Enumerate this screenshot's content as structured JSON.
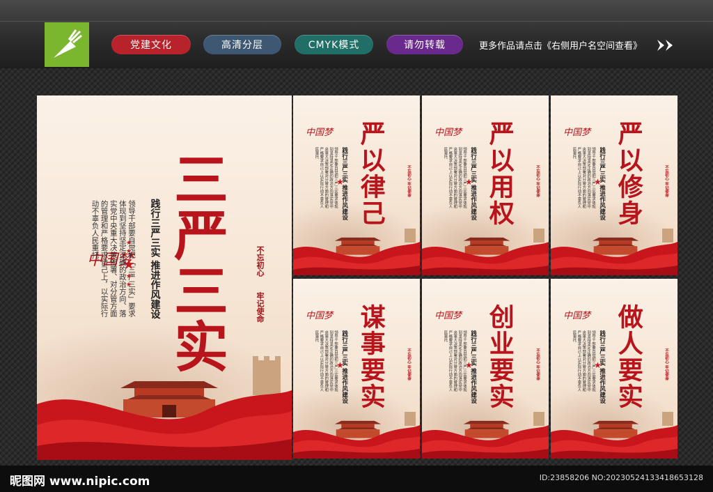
{
  "header": {
    "tags": [
      "党建文化",
      "高清分层",
      "CMYK模式",
      "请勿转载"
    ],
    "more_text": "更多作品请点击《右侧用户名空间查看》",
    "logo_icon": "pen-nib-icon",
    "arrow_icon": "double-chevron-right-icon"
  },
  "main_poster": {
    "title": "三严三实",
    "brand": "中国梦",
    "subtitle": "践行三严三实 推进作风建设",
    "body": "领导干部要自觉把「三严三实」要求体现到坚持坚定正确的政治方向、落实党中央重大决策部署、对分管方面的管理和严格要求自己上，以实际行动不辜负人民重托。",
    "slogan1": "不忘初心",
    "slogan2": "牢记使命"
  },
  "small_posters": [
    {
      "title": "严以律己"
    },
    {
      "title": "严以用权"
    },
    {
      "title": "严以修身"
    },
    {
      "title": "谋事要实"
    },
    {
      "title": "创业要实"
    },
    {
      "title": "做人要实"
    }
  ],
  "small_common": {
    "brand": "中国梦",
    "subtitle": "践行三严三实 推进作风建设",
    "body": "领导干部要自觉把三严三实要求体现到坚持坚定正确的政治方向落实党中央重大决策部署对分管方面的管理和严格要求自己上以实际行动不辜负人民重托",
    "slogan": "不忘初心 牢记使命"
  },
  "footer": {
    "site": "昵图网 www.nipic.com",
    "image_id": "ID:23858206 NO:20230524133418653128"
  },
  "colors": {
    "accent": "#b8141c",
    "logo": "#7ab62e"
  }
}
